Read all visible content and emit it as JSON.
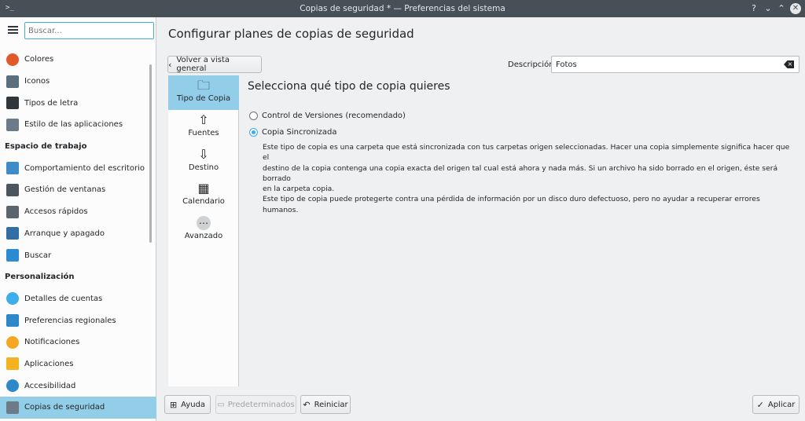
{
  "window": {
    "title": "Copias de seguridad * — Preferencias del sistema",
    "controls": [
      "?",
      "⌄",
      "⌃",
      "✕"
    ]
  },
  "sidebar": {
    "search_placeholder": "Buscar...",
    "items": [
      {
        "type": "item",
        "label": "Colores",
        "icon": "colors-icon",
        "color": "#e05a2b"
      },
      {
        "type": "item",
        "label": "Iconos",
        "icon": "icons-icon",
        "color": "#5b6d7e"
      },
      {
        "type": "item",
        "label": "Tipos de letra",
        "icon": "font-icon",
        "color": "#31363b"
      },
      {
        "type": "item",
        "label": "Estilo de las aplicaciones",
        "icon": "app-style-icon",
        "color": "#6d7b88"
      },
      {
        "type": "section",
        "label": "Espacio de trabajo"
      },
      {
        "type": "item",
        "label": "Comportamiento del escritorio",
        "icon": "desktop-behavior-icon",
        "color": "#3d8bc9"
      },
      {
        "type": "item",
        "label": "Gestión de ventanas",
        "icon": "window-management-icon",
        "color": "#4a5560"
      },
      {
        "type": "item",
        "label": "Accesos rápidos",
        "icon": "shortcuts-icon",
        "color": "#5b6570"
      },
      {
        "type": "item",
        "label": "Arranque y apagado",
        "icon": "startup-shutdown-icon",
        "color": "#2f6fa3"
      },
      {
        "type": "item",
        "label": "Buscar",
        "icon": "search-icon",
        "color": "#2a8bd4"
      },
      {
        "type": "section",
        "label": "Personalización"
      },
      {
        "type": "item",
        "label": "Detalles de cuentas",
        "icon": "account-icon",
        "color": "#3daee9"
      },
      {
        "type": "item",
        "label": "Preferencias regionales",
        "icon": "regional-icon",
        "color": "#2e89c9"
      },
      {
        "type": "item",
        "label": "Notificaciones",
        "icon": "notifications-icon",
        "color": "#f6a623"
      },
      {
        "type": "item",
        "label": "Aplicaciones",
        "icon": "applications-icon",
        "color": "#f4b120"
      },
      {
        "type": "item",
        "label": "Accesibilidad",
        "icon": "accessibility-icon",
        "color": "#2e89c9"
      },
      {
        "type": "item",
        "label": "Copias de seguridad",
        "icon": "backup-icon",
        "color": "#6d7b88",
        "selected": true
      }
    ]
  },
  "main": {
    "page_title": "Configurar planes de copias de seguridad",
    "back_button": "Volver a vista general",
    "description_label": "Descripción:",
    "description_value": "Fotos",
    "tabs": [
      {
        "label": "Tipo de Copia",
        "icon": "folder-backup-icon",
        "selected": true
      },
      {
        "label": "Fuentes",
        "icon": "sources-upload-icon"
      },
      {
        "label": "Destino",
        "icon": "destination-download-icon"
      },
      {
        "label": "Calendario",
        "icon": "calendar-icon"
      },
      {
        "label": "Avanzado",
        "icon": "more-icon"
      }
    ],
    "panel_title": "Selecciona qué tipo de copia quieres",
    "options": [
      {
        "label": "Control de Versiones (recomendado)",
        "checked": false
      },
      {
        "label": "Copia Sincronizada",
        "checked": true
      }
    ],
    "help_lines": [
      "Este tipo de copia es una carpeta que está sincronizada con tus carpetas origen seleccionadas. Hacer una copia simplemente significa hacer que el",
      "destino de la copia contenga una copia exacta del origen tal cual está ahora y nada más. Si un archivo ha sido borrado en el origen, éste será borrado",
      "en la carpeta copia.",
      "Este tipo de copia puede protegerte contra una pérdida de información por un disco duro defectuoso, pero no ayudar a recuperar errores humanos."
    ]
  },
  "footer": {
    "help": "Ayuda",
    "defaults": "Predeterminados",
    "reset": "Reiniciar",
    "apply": "Aplicar"
  }
}
